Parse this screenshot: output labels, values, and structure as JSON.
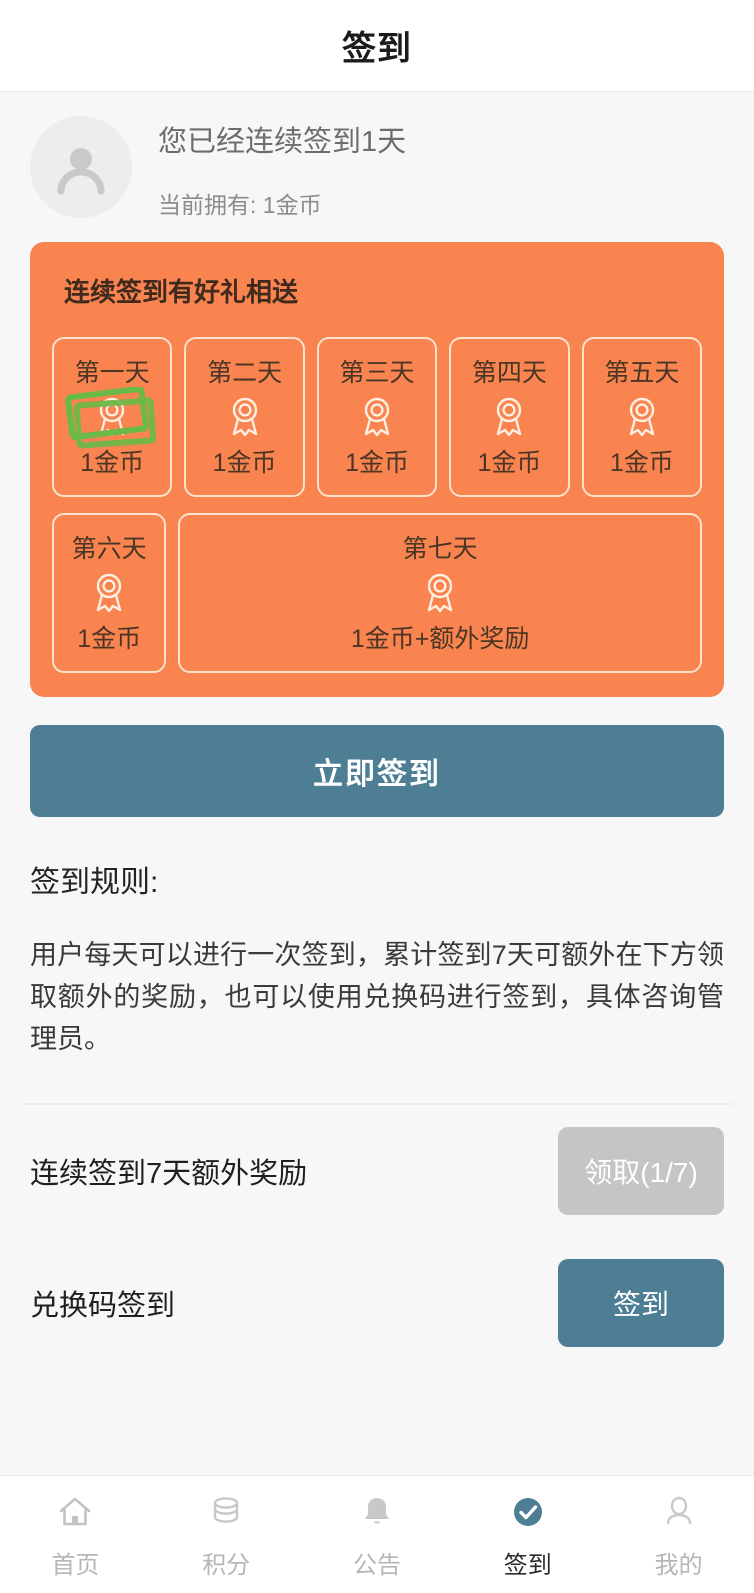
{
  "header": {
    "title": "签到"
  },
  "user": {
    "avatar_icon": "user-placeholder-icon",
    "streak_text": "您已经连续签到1天",
    "balance_text": "当前拥有: 1金币"
  },
  "reward_card": {
    "title": "连续签到有好礼相送",
    "accent_color": "#f98450",
    "border_color": "#fbe3cd",
    "annotation": {
      "shape": "hand-drawn-rectangle",
      "color": "#6aba4a",
      "target": "day-1-medal-icon"
    },
    "days": [
      {
        "label": "第一天",
        "reward": "1金币",
        "icon": "medal-icon",
        "highlighted": true
      },
      {
        "label": "第二天",
        "reward": "1金币",
        "icon": "medal-icon",
        "highlighted": false
      },
      {
        "label": "第三天",
        "reward": "1金币",
        "icon": "medal-icon",
        "highlighted": false
      },
      {
        "label": "第四天",
        "reward": "1金币",
        "icon": "medal-icon",
        "highlighted": false
      },
      {
        "label": "第五天",
        "reward": "1金币",
        "icon": "medal-icon",
        "highlighted": false
      },
      {
        "label": "第六天",
        "reward": "1金币",
        "icon": "medal-icon",
        "highlighted": false
      },
      {
        "label": "第七天",
        "reward": "1金币+额外奖励",
        "icon": "medal-icon",
        "highlighted": false
      }
    ]
  },
  "primary_button": {
    "label": "立即签到",
    "color": "#4d7e94"
  },
  "rules": {
    "heading": "签到规则:",
    "text": "用户每天可以进行一次签到，累计签到7天可额外在下方领取额外的奖励，也可以使用兑换码进行签到，具体咨询管理员。"
  },
  "actions": [
    {
      "label": "连续签到7天额外奖励",
      "button_label": "领取(1/7)",
      "button_state": "disabled",
      "button_color": "#c5c5c7"
    },
    {
      "label": "兑换码签到",
      "button_label": "签到",
      "button_state": "enabled",
      "button_color": "#4d7e94"
    }
  ],
  "tabbar": {
    "active_color": "#4d7e94",
    "items": [
      {
        "label": "首页",
        "icon": "home-icon",
        "active": false
      },
      {
        "label": "积分",
        "icon": "coin-stack-icon",
        "active": false
      },
      {
        "label": "公告",
        "icon": "bell-icon",
        "active": false
      },
      {
        "label": "签到",
        "icon": "check-circle-icon",
        "active": true
      },
      {
        "label": "我的",
        "icon": "person-icon",
        "active": false
      }
    ]
  }
}
